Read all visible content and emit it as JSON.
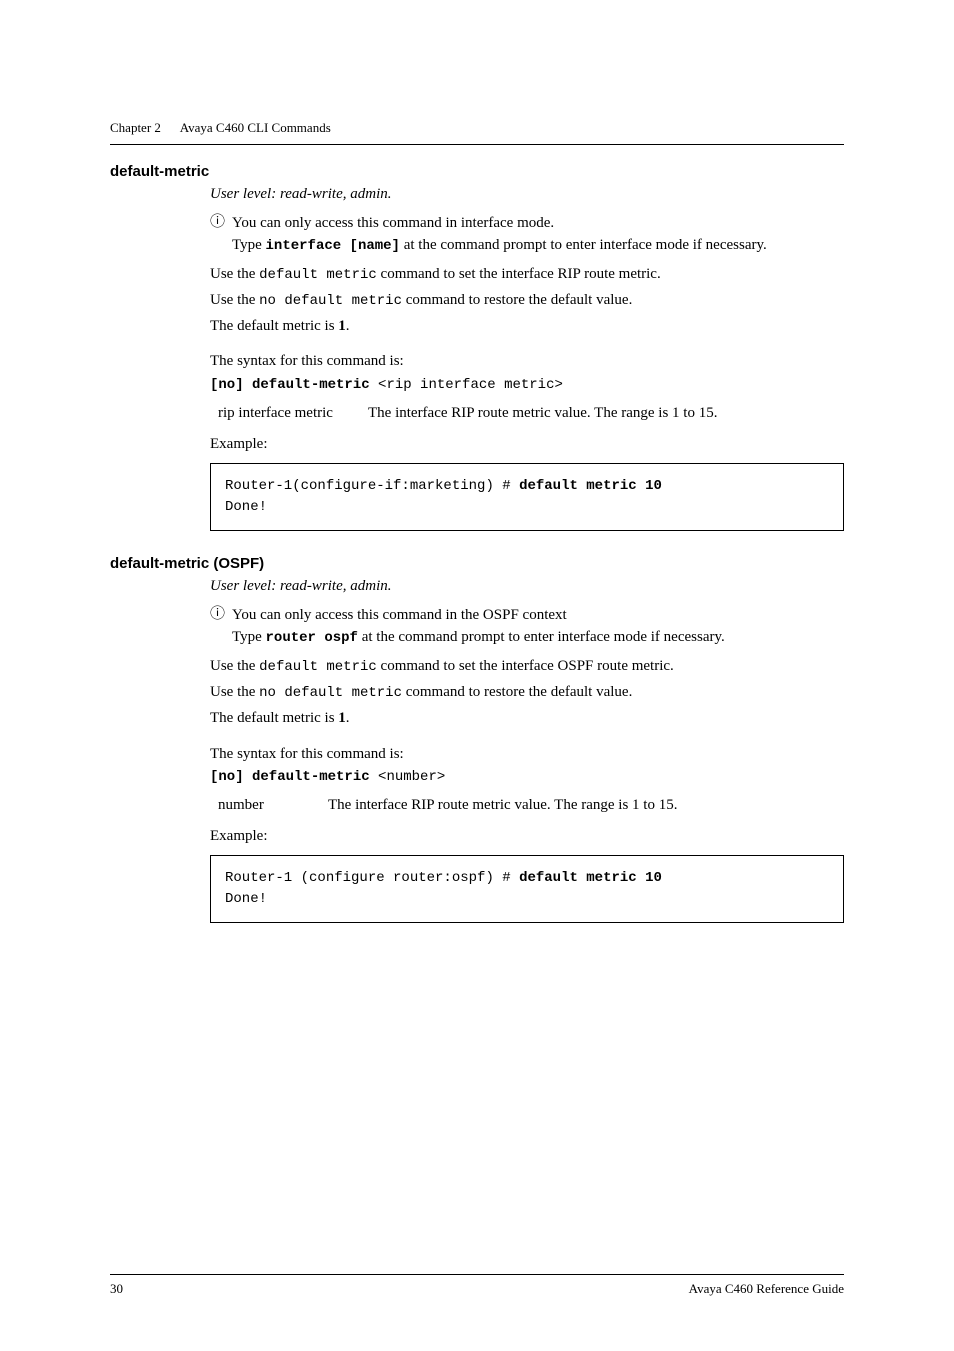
{
  "running_head": {
    "chapter": "Chapter 2",
    "title": "Avaya C460 CLI Commands"
  },
  "section1": {
    "heading": "default-metric",
    "user_level": "User level: read-write, admin.",
    "note_line1": "You can only access this command in interface mode.",
    "note_line2_pre": "Type ",
    "note_line2_cmd": "interface [name]",
    "note_line2_post": " at the command prompt to enter interface mode if necessary.",
    "p1_pre": "Use the ",
    "p1_cmd": "default metric",
    "p1_post": " command to set the interface RIP route metric.",
    "p2_pre": "Use the ",
    "p2_cmd": "no default metric",
    "p2_post": " command to restore the default value.",
    "p3_pre": "The default metric is ",
    "p3_val": "1",
    "p3_post": ".",
    "syntax_label": "The syntax for this command is:",
    "syntax_bold": "[no] default-metric",
    "syntax_rest": " <rip interface metric>",
    "param_name": "rip interface metric",
    "param_desc": "The interface RIP route metric value. The range is 1 to 15.",
    "example_label": "Example:",
    "code_line1_a": "Router-1(configure-if:marketing) # ",
    "code_line1_b": "default metric 10",
    "code_line2": "Done!"
  },
  "section2": {
    "heading": "default-metric (OSPF)",
    "user_level": "User level: read-write, admin.",
    "note_line1": "You can only access this command in the OSPF context",
    "note_line2_pre": "Type ",
    "note_line2_cmd": "router ospf",
    "note_line2_post": " at the command prompt to enter interface mode if necessary.",
    "p1_pre": "Use the ",
    "p1_cmd": "default metric",
    "p1_post": " command to set the interface OSPF route metric.",
    "p2_pre": "Use the ",
    "p2_cmd": "no default metric",
    "p2_post": " command to restore the default value.",
    "p3_pre": "The default metric is ",
    "p3_val": "1",
    "p3_post": ".",
    "syntax_label": "The syntax for this command is:",
    "syntax_bold": "[no] default-metric",
    "syntax_rest": " <number>",
    "param_name": "number",
    "param_desc": "The interface RIP route metric value. The range is 1 to 15.",
    "example_label": "Example:",
    "code_line1_a": "Router-1 (configure router:ospf) # ",
    "code_line1_b": "default metric 10",
    "code_line2": "Done!"
  },
  "footer": {
    "page": "30",
    "doc": "Avaya C460 Reference Guide"
  }
}
